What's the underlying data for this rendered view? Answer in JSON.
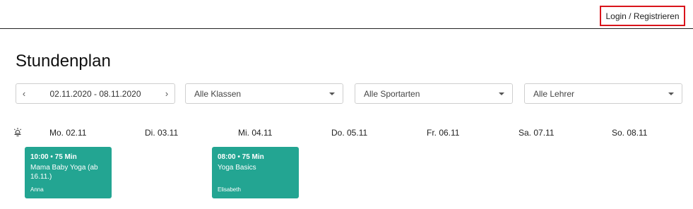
{
  "header": {
    "login_label": "Login / Registrieren"
  },
  "page": {
    "title": "Stundenplan"
  },
  "filters": {
    "date_range": "02.11.2020 - 08.11.2020",
    "prev_icon": "chevron-left-icon",
    "next_icon": "chevron-right-icon",
    "klassen": "Alle Klassen",
    "sportarten": "Alle Sportarten",
    "lehrer": "Alle Lehrer"
  },
  "schedule": {
    "days": [
      "Mo. 02.11",
      "Di. 03.11",
      "Mi. 04.11",
      "Do. 05.11",
      "Fr. 06.11",
      "Sa. 07.11",
      "So. 08.11"
    ],
    "classes": [
      {
        "time": "10:00 • 75 Min",
        "name": "Mama Baby Yoga (ab 16.11.)",
        "teacher": "Anna"
      },
      {
        "time": "08:00 • 75 Min",
        "name": "Yoga Basics",
        "teacher": "Elisabeth"
      }
    ],
    "card_color": "#23a592"
  }
}
